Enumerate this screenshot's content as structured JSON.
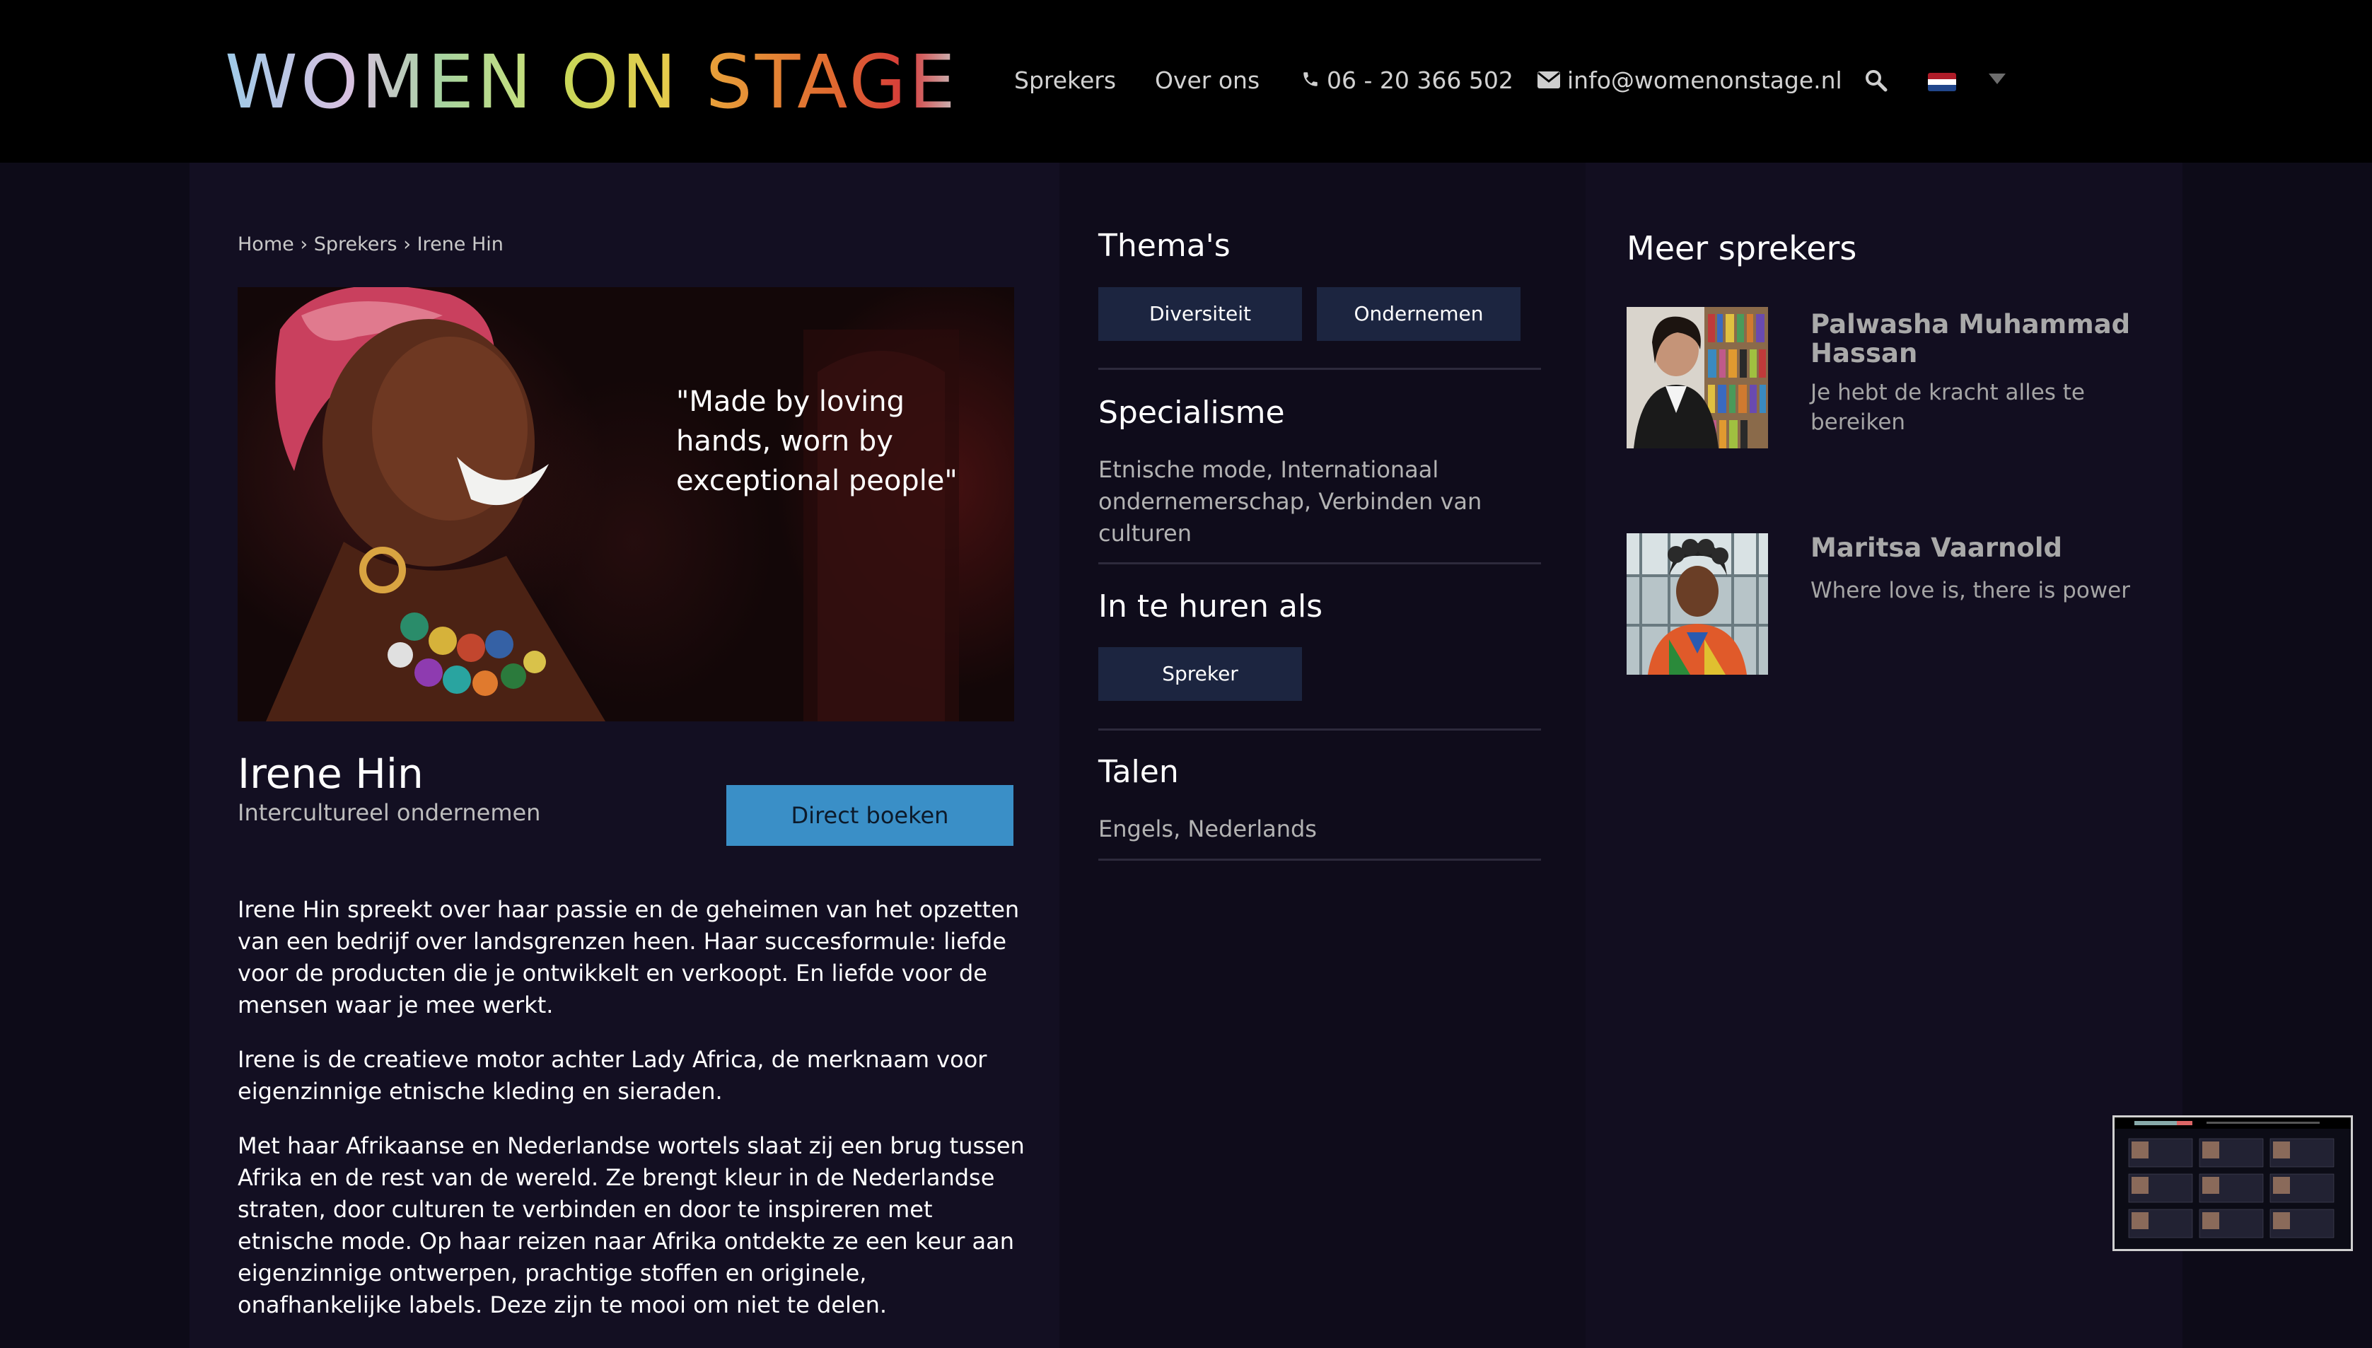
{
  "header": {
    "logo": {
      "word1": "WOMEN",
      "word2": "ON",
      "word3": "STAGE"
    },
    "nav": [
      {
        "label": "Sprekers"
      },
      {
        "label": "Over ons"
      },
      {
        "label": "06 - 20 366 502",
        "icon": "phone-icon"
      },
      {
        "label": "info@womenonstage.nl",
        "icon": "envelope-icon"
      }
    ],
    "search_icon": "search-icon",
    "language": {
      "flag": "netherlands-flag-icon",
      "colors": [
        "#ae1c28",
        "#ffffff",
        "#21468b"
      ]
    }
  },
  "breadcrumb": [
    "Home",
    "Sprekers",
    "Irene Hin"
  ],
  "breadcrumb_sep": "›",
  "hero": {
    "quote": "\"Made by loving\nhands, worn by\nexceptional people\""
  },
  "speaker": {
    "name": "Irene Hin",
    "subtitle": "Intercultureel ondernemen",
    "book_button": "Direct boeken"
  },
  "bio": [
    "Irene Hin spreekt over haar passie en de geheimen van het opzetten van een bedrijf over landsgrenzen heen. Haar succesformule: liefde voor de producten die je ontwikkelt en verkoopt. En liefde voor de mensen waar je mee werkt.",
    "Irene is de creatieve motor achter Lady Africa, de merknaam voor eigenzinnige etnische kleding en sieraden.",
    "Met haar Afrikaanse en Nederlandse wortels slaat zij een brug tussen Afrika en de rest van de wereld. Ze brengt kleur in de Nederlandse straten, door culturen te verbinden en door te inspireren met etnische mode. Op haar reizen naar Afrika ontdekte ze een keur aan eigenzinnige ontwerpen, prachtige stoffen en originele, onafhankelijke labels. Deze zijn te mooi om niet te delen."
  ],
  "sidebar": {
    "themes_title": "Thema's",
    "themes": [
      "Diversiteit",
      "Ondernemen"
    ],
    "specialism_title": "Specialisme",
    "specialism": "Etnische mode, Internationaal ondernemerschap, Verbinden van culturen",
    "hire_title": "In te huren als",
    "hire": [
      "Spreker"
    ],
    "languages_title": "Talen",
    "languages": "Engels, Nederlands"
  },
  "more_speakers": {
    "title": "Meer sprekers",
    "items": [
      {
        "name": "Palwasha Muhammad Hassan",
        "tagline": "Je hebt de kracht alles te bereiken"
      },
      {
        "name": "Maritsa Vaarnold",
        "tagline": "Where love is, there is power"
      }
    ]
  },
  "colors": {
    "header_bg": "#000000",
    "page_bg": "#0d0b18",
    "accent_button": "#3a8fc7",
    "tag_bg": "#1c2540"
  }
}
